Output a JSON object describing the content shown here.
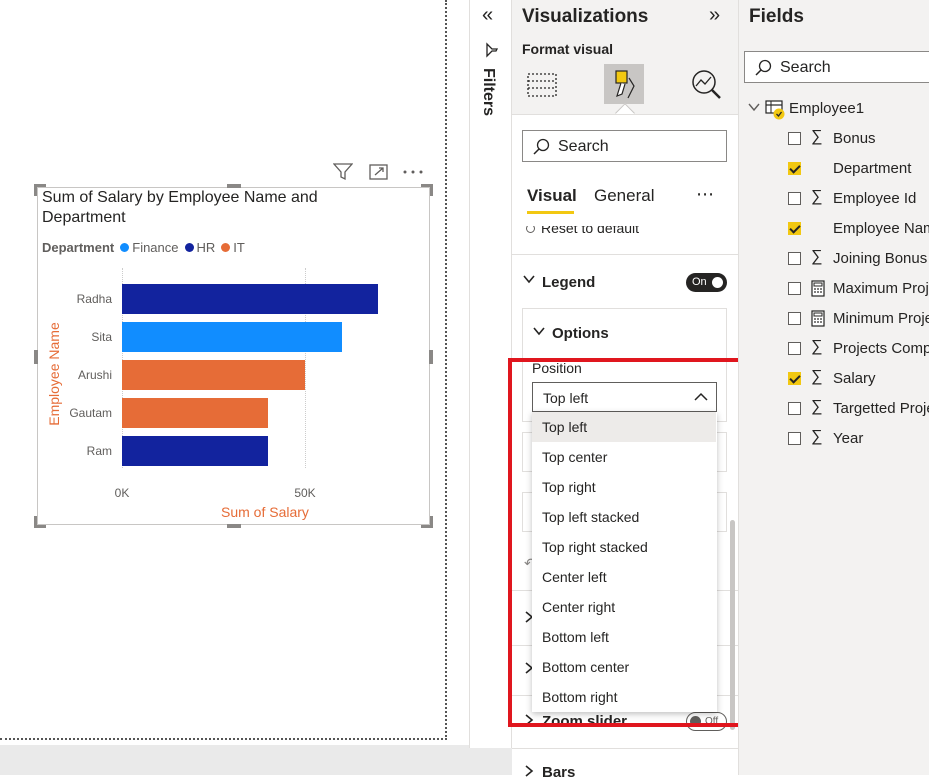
{
  "visual": {
    "title_line1": "Sum of Salary by Employee Name and",
    "title_line2": "Department",
    "legend_title": "Department",
    "legend": [
      {
        "name": "Finance",
        "color": "#118dff"
      },
      {
        "name": "HR",
        "color": "#12239e"
      },
      {
        "name": "IT",
        "color": "#e66c37"
      }
    ],
    "header_icons": [
      "filter-icon",
      "focus-mode-icon",
      "more-options-icon"
    ]
  },
  "chart_data": {
    "type": "bar",
    "orientation": "horizontal",
    "categories": [
      "Radha",
      "Sita",
      "Arushi",
      "Gautam",
      "Ram"
    ],
    "values": [
      70000,
      60000,
      50000,
      40000,
      40000
    ],
    "bar_department": [
      "HR",
      "Finance",
      "IT",
      "IT",
      "HR"
    ],
    "xlabel": "Sum of Salary",
    "ylabel": "Employee Name",
    "xticks": [
      "0K",
      "50K"
    ],
    "xlim": [
      0,
      100000
    ],
    "legend_position": "top-left"
  },
  "filters": {
    "label": "Filters"
  },
  "viz": {
    "title": "Visualizations",
    "subtitle": "Format visual",
    "search_placeholder": "Search",
    "tabs": [
      {
        "label": "Visual",
        "active": true
      },
      {
        "label": "General",
        "active": false
      }
    ],
    "more": "⋯",
    "reset": "Reset to default",
    "legend_section": "Legend",
    "legend_toggle": "On",
    "options_section": "Options",
    "position_label": "Position",
    "position_value": "Top left",
    "position_options": [
      "Top left",
      "Top center",
      "Top right",
      "Top left stacked",
      "Top right stacked",
      "Center left",
      "Center right",
      "Bottom left",
      "Bottom center",
      "Bottom right"
    ],
    "zoom_section": "Zoom slider",
    "zoom_toggle": "Off",
    "bars_section": "Bars",
    "highlight_color": "#e0161e"
  },
  "fields": {
    "title": "Fields",
    "search_placeholder": "Search",
    "table": "Employee1",
    "items": [
      {
        "label": "Bonus",
        "sigma": true,
        "calc": false,
        "checked": false
      },
      {
        "label": "Department",
        "sigma": false,
        "calc": false,
        "checked": true
      },
      {
        "label": "Employee Id",
        "sigma": true,
        "calc": false,
        "checked": false
      },
      {
        "label": "Employee Name",
        "sigma": false,
        "calc": false,
        "checked": true
      },
      {
        "label": "Joining Bonus",
        "sigma": true,
        "calc": false,
        "checked": false
      },
      {
        "label": "Maximum Projects",
        "sigma": false,
        "calc": true,
        "checked": false
      },
      {
        "label": "Minimum Projects",
        "sigma": false,
        "calc": true,
        "checked": false
      },
      {
        "label": "Projects Completed",
        "sigma": true,
        "calc": false,
        "checked": false
      },
      {
        "label": "Salary",
        "sigma": true,
        "calc": false,
        "checked": true
      },
      {
        "label": "Targetted Projects",
        "sigma": true,
        "calc": false,
        "checked": false
      },
      {
        "label": "Year",
        "sigma": true,
        "calc": false,
        "checked": false
      }
    ]
  }
}
